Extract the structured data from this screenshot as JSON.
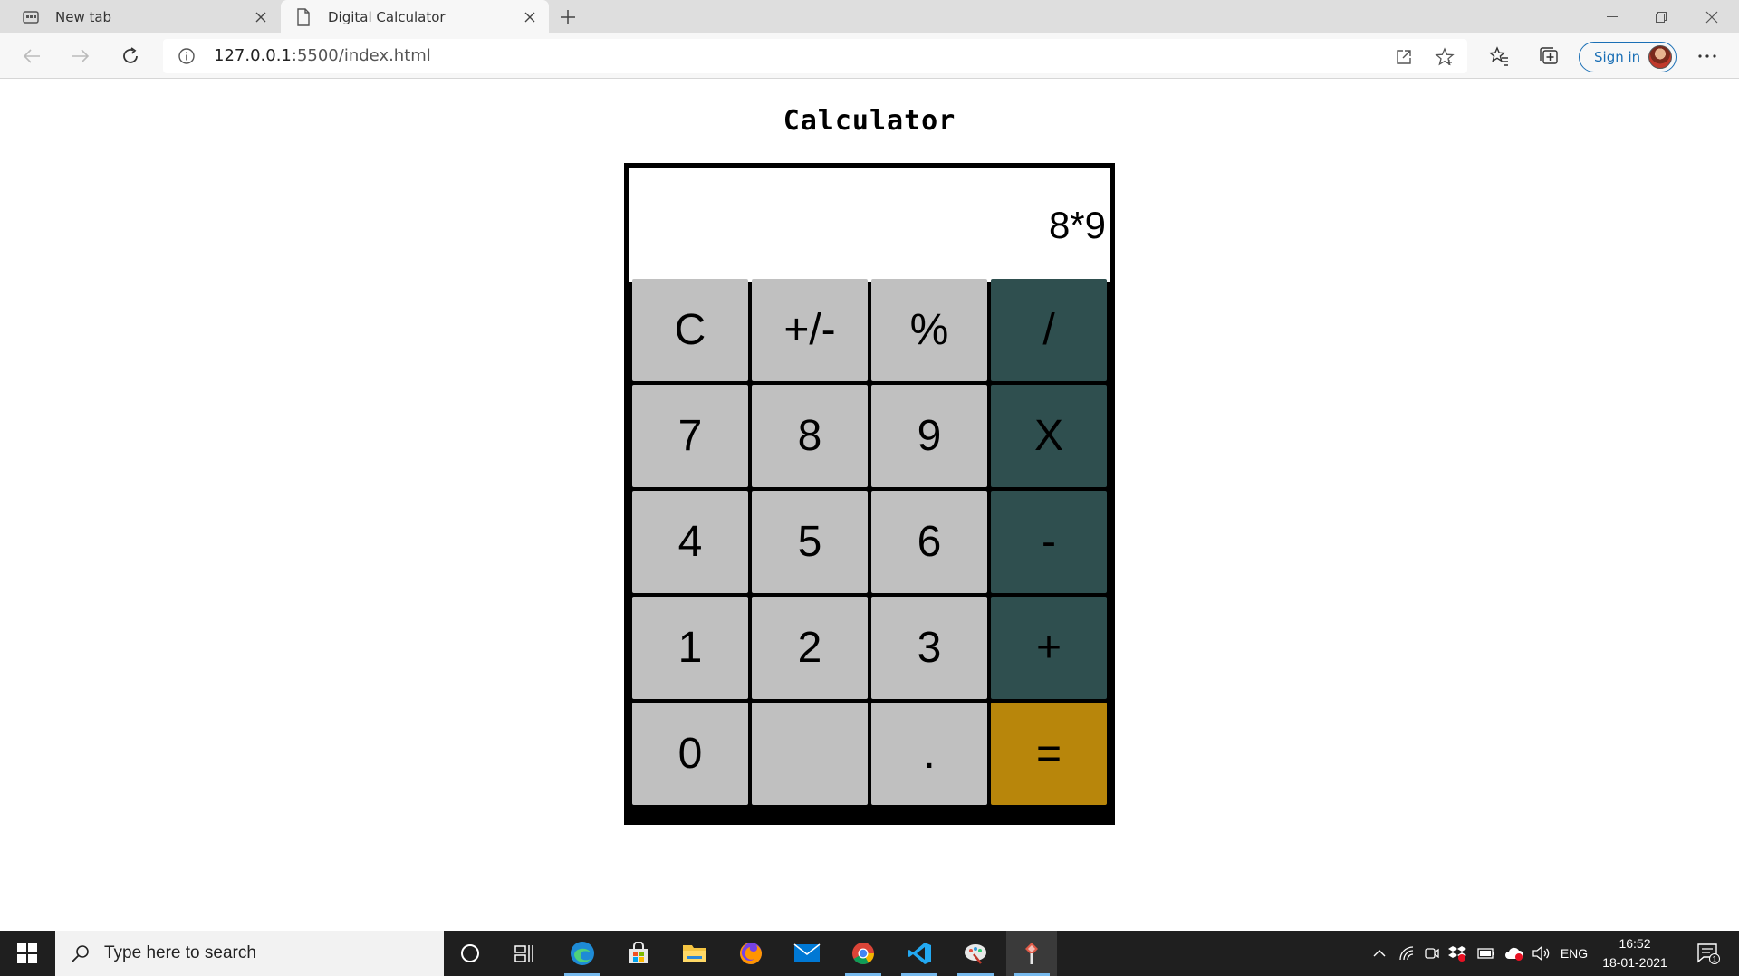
{
  "browser": {
    "tabs": [
      {
        "title": "New tab",
        "icon": "newtab-icon",
        "active": false
      },
      {
        "title": "Digital Calculator",
        "icon": "page-icon",
        "active": true
      }
    ],
    "address": {
      "host": "127.0.0.1",
      "rest": ":5500/index.html"
    },
    "sign_in_label": "Sign in"
  },
  "page": {
    "title": "Calculator",
    "display_value": "8*9",
    "keys": [
      {
        "label": "C",
        "kind": "num"
      },
      {
        "label": "+/-",
        "kind": "num"
      },
      {
        "label": "%",
        "kind": "num"
      },
      {
        "label": "/",
        "kind": "op"
      },
      {
        "label": "7",
        "kind": "num"
      },
      {
        "label": "8",
        "kind": "num"
      },
      {
        "label": "9",
        "kind": "num"
      },
      {
        "label": "X",
        "kind": "op"
      },
      {
        "label": "4",
        "kind": "num"
      },
      {
        "label": "5",
        "kind": "num"
      },
      {
        "label": "6",
        "kind": "num"
      },
      {
        "label": "-",
        "kind": "op"
      },
      {
        "label": "1",
        "kind": "num"
      },
      {
        "label": "2",
        "kind": "num"
      },
      {
        "label": "3",
        "kind": "num"
      },
      {
        "label": "+",
        "kind": "op"
      },
      {
        "label": "0",
        "kind": "num"
      },
      {
        "label": "",
        "kind": "num"
      },
      {
        "label": ".",
        "kind": "num"
      },
      {
        "label": "=",
        "kind": "eq"
      }
    ],
    "colors": {
      "key": "#c0c0c0",
      "operator": "#2f4f4f",
      "equals": "#b8860b"
    }
  },
  "taskbar": {
    "search_placeholder": "Type here to search",
    "apps": [
      "cortana-icon",
      "task-view-icon",
      "edge-icon",
      "store-icon",
      "file-explorer-icon",
      "firefox-icon",
      "mail-icon",
      "chrome-icon",
      "vscode-icon",
      "paint-icon",
      "app-icon"
    ],
    "language": "ENG",
    "time": "16:52",
    "date": "18-01-2021",
    "notification_count": "1"
  }
}
